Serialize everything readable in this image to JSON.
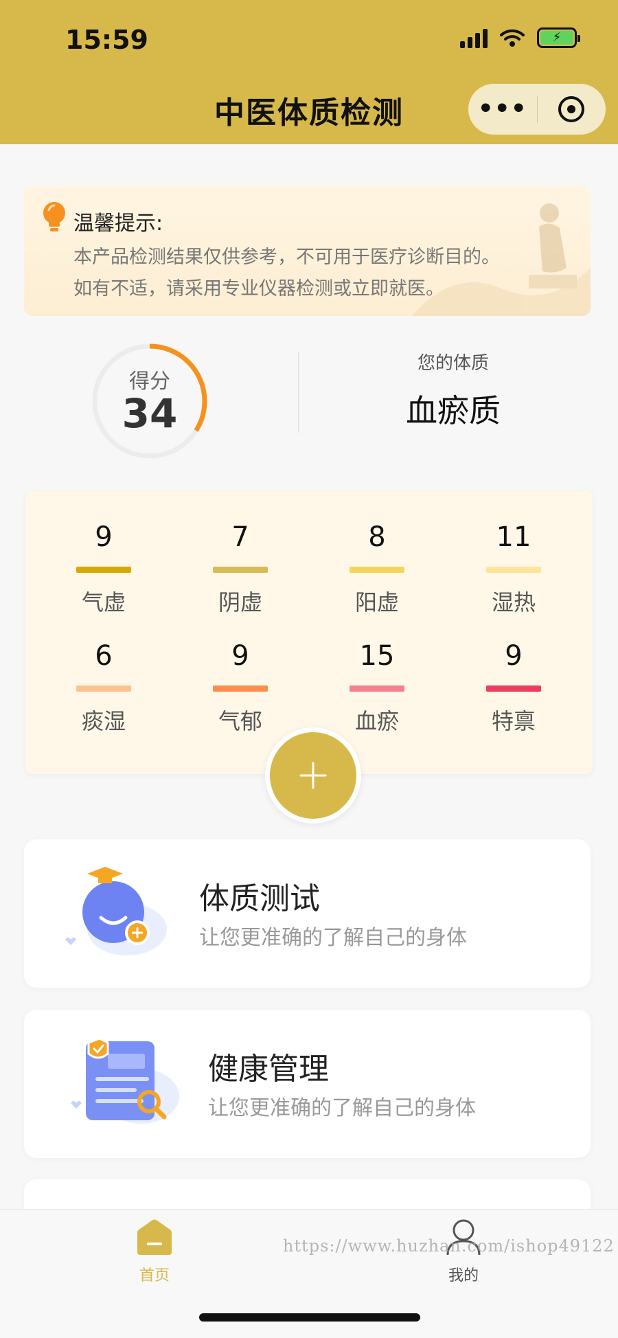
{
  "status_bar": {
    "time": "15:59"
  },
  "nav": {
    "title": "中医体质检测",
    "menu_dots": "•••"
  },
  "tip": {
    "title": "温馨提示:",
    "line1": "本产品检测结果仅供参考，不可用于医疗诊断目的。",
    "line2": "如有不适，请采用专业仪器检测或立即就医。"
  },
  "score": {
    "label": "得分",
    "value": "34",
    "percent": 34
  },
  "constitution": {
    "label": "您的体质",
    "value": "血瘀质"
  },
  "categories": [
    {
      "num": "9",
      "label": "气虚",
      "color": "#d7a906"
    },
    {
      "num": "7",
      "label": "阴虚",
      "color": "#d6bb56"
    },
    {
      "num": "8",
      "label": "阳虚",
      "color": "#f5d45e"
    },
    {
      "num": "11",
      "label": "湿热",
      "color": "#fce59b"
    },
    {
      "num": "6",
      "label": "痰湿",
      "color": "#fcc38f"
    },
    {
      "num": "9",
      "label": "气郁",
      "color": "#fb8f50"
    },
    {
      "num": "15",
      "label": "血瘀",
      "color": "#f57f8d"
    },
    {
      "num": "9",
      "label": "特禀",
      "color": "#ef3b5e"
    }
  ],
  "features": [
    {
      "title": "体质测试",
      "subtitle": "让您更准确的了解自己的身体"
    },
    {
      "title": "健康管理",
      "subtitle": "让您更准确的了解自己的身体"
    }
  ],
  "tabbar": {
    "home": "首页",
    "mine": "我的",
    "active_color": "#d7b94b",
    "inactive_color": "#555555"
  },
  "watermark": "https://www.huzhan.com/ishop49122",
  "colors": {
    "brand": "#d7b94b",
    "score_arc": "#f5911e"
  }
}
